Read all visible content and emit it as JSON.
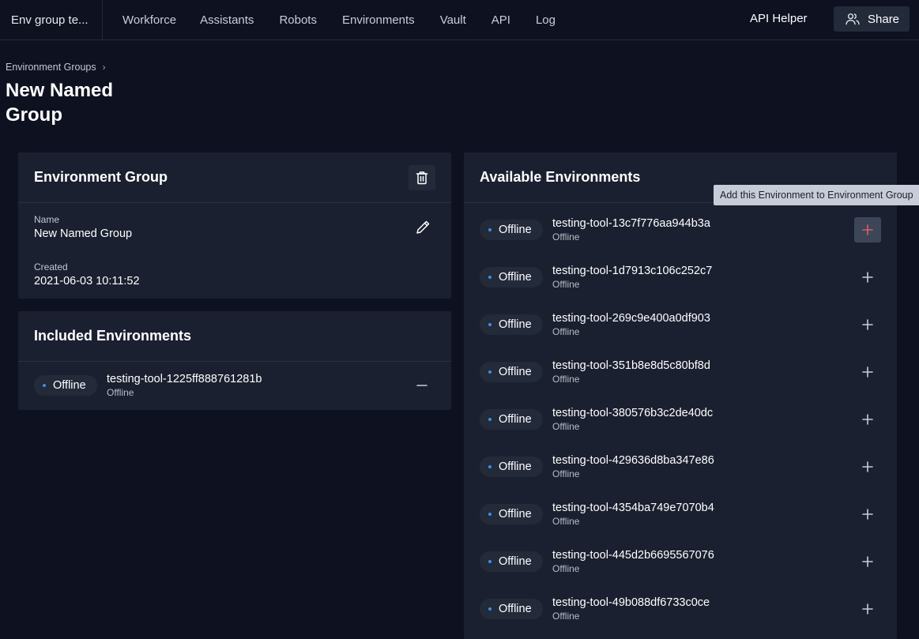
{
  "topbar": {
    "workspace_name": "Env group te...",
    "nav_items": [
      {
        "label": "Workforce"
      },
      {
        "label": "Assistants"
      },
      {
        "label": "Robots"
      },
      {
        "label": "Environments"
      },
      {
        "label": "Vault"
      },
      {
        "label": "API"
      },
      {
        "label": "Log"
      }
    ],
    "api_helper_label": "API Helper",
    "share_label": "Share",
    "share_icon": "users-icon"
  },
  "header": {
    "breadcrumb": "Environment Groups",
    "breadcrumb_separator": "›",
    "title": "New Named Group"
  },
  "environment_group": {
    "title": "Environment Group",
    "delete_icon": "trash-icon",
    "name_label": "Name",
    "name_value": "New Named Group",
    "edit_icon": "pencil-icon",
    "created_label": "Created",
    "created_value": "2021-06-03 10:11:52"
  },
  "included": {
    "title": "Included Environments",
    "items": [
      {
        "status": "Offline",
        "name": "testing-tool-1225ff888761281b",
        "substatus": "Offline",
        "action": "remove"
      }
    ]
  },
  "available": {
    "title": "Available Environments",
    "tooltip": "Add this Environment to Environment Group",
    "items": [
      {
        "status": "Offline",
        "name": "testing-tool-13c7f776aa944b3a",
        "substatus": "Offline",
        "action": "add",
        "hovered": true
      },
      {
        "status": "Offline",
        "name": "testing-tool-1d7913c106c252c7",
        "substatus": "Offline",
        "action": "add"
      },
      {
        "status": "Offline",
        "name": "testing-tool-269c9e400a0df903",
        "substatus": "Offline",
        "action": "add"
      },
      {
        "status": "Offline",
        "name": "testing-tool-351b8e8d5c80bf8d",
        "substatus": "Offline",
        "action": "add"
      },
      {
        "status": "Offline",
        "name": "testing-tool-380576b3c2de40dc",
        "substatus": "Offline",
        "action": "add"
      },
      {
        "status": "Offline",
        "name": "testing-tool-429636d8ba347e86",
        "substatus": "Offline",
        "action": "add"
      },
      {
        "status": "Offline",
        "name": "testing-tool-4354ba749e7070b4",
        "substatus": "Offline",
        "action": "add"
      },
      {
        "status": "Offline",
        "name": "testing-tool-445d2b6695567076",
        "substatus": "Offline",
        "action": "add"
      },
      {
        "status": "Offline",
        "name": "testing-tool-49b088df6733c0ce",
        "substatus": "Offline",
        "action": "add"
      }
    ]
  },
  "colors": {
    "background": "#0e1120",
    "card": "#1b2030",
    "status_dot": "#3d8fe0",
    "add_hover": "#e05c5c",
    "tooltip_bg": "#c7ccd8"
  }
}
